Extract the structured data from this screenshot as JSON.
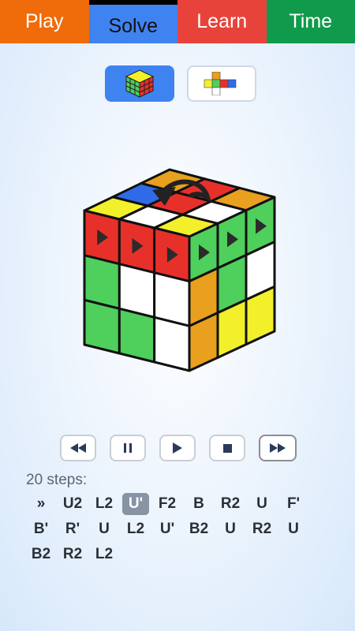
{
  "tabs": [
    {
      "label": "Play"
    },
    {
      "label": "Solve"
    },
    {
      "label": "Learn"
    },
    {
      "label": "Time"
    }
  ],
  "active_tab": "Solve",
  "view_toggle": {
    "selected": "3d-cube",
    "options": [
      "3d-cube-icon",
      "cube-net-icon"
    ]
  },
  "colors": {
    "red": "#e8302a",
    "green": "#4fcf5b",
    "white": "#ffffff",
    "yellow": "#f2f02a",
    "orange": "#e8a01e",
    "blue": "#2f6be8"
  },
  "playback": [
    "rewind-icon",
    "pause-icon",
    "play-icon",
    "stop-icon",
    "fast-forward-icon"
  ],
  "steps_label": "20 steps:",
  "moves": [
    "»",
    "U2",
    "L2",
    "U'",
    "F2",
    "B",
    "R2",
    "U",
    "F'",
    "B'",
    "R'",
    "U",
    "L2",
    "U'",
    "B2",
    "U",
    "R2",
    "U",
    "B2",
    "R2",
    "L2"
  ],
  "current_move_index": 3
}
